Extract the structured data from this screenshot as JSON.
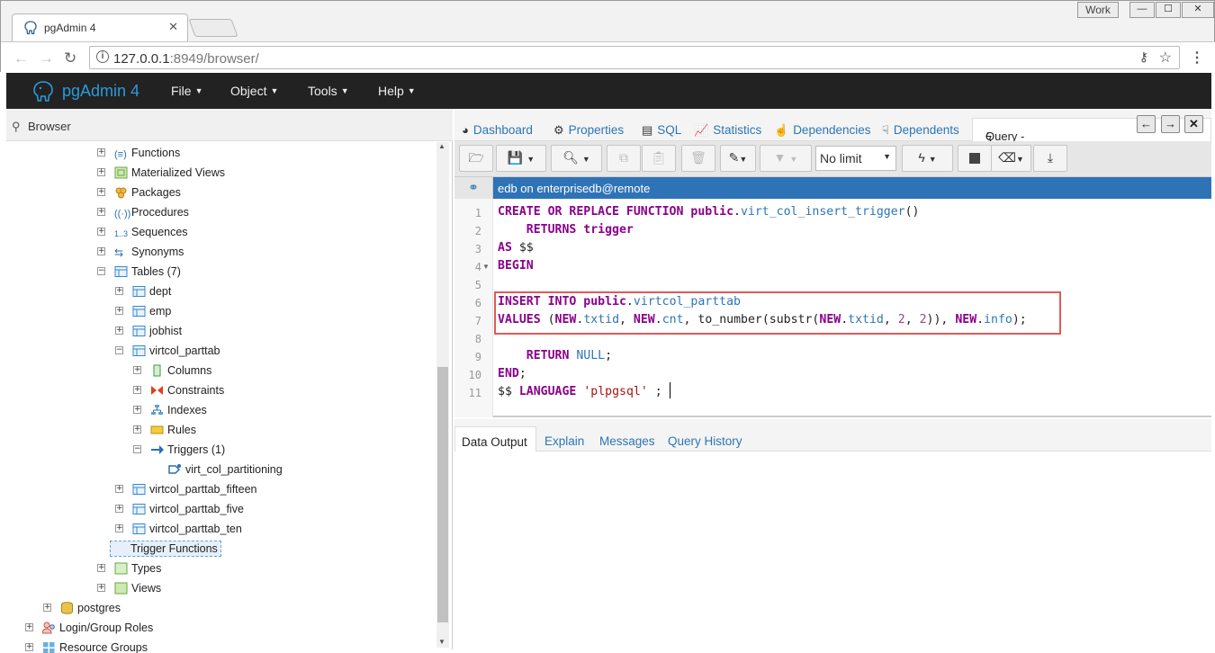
{
  "browser": {
    "tab_title": "pgAdmin 4",
    "profile_label": "Work",
    "url_host": "127.0.0.1",
    "url_rest": ":8949/browser/"
  },
  "app": {
    "name": "pgAdmin 4",
    "menus": [
      "File",
      "Object",
      "Tools",
      "Help"
    ]
  },
  "browser_panel": {
    "title": "Browser",
    "tree": [
      {
        "label": "Functions",
        "level": 3,
        "expander": "+",
        "icon": "functions-icon"
      },
      {
        "label": "Materialized Views",
        "level": 3,
        "expander": "+",
        "icon": "materialized-views-icon"
      },
      {
        "label": "Packages",
        "level": 3,
        "expander": "+",
        "icon": "packages-icon"
      },
      {
        "label": "Procedures",
        "level": 3,
        "expander": "+",
        "icon": "procedures-icon"
      },
      {
        "label": "Sequences",
        "level": 3,
        "expander": "+",
        "icon": "sequences-icon"
      },
      {
        "label": "Synonyms",
        "level": 3,
        "expander": "+",
        "icon": "synonyms-icon"
      },
      {
        "label": "Tables (7)",
        "level": 3,
        "expander": "−",
        "icon": "tables-icon"
      },
      {
        "label": "dept",
        "level": 4,
        "expander": "+",
        "icon": "table-icon"
      },
      {
        "label": "emp",
        "level": 4,
        "expander": "+",
        "icon": "table-icon"
      },
      {
        "label": "jobhist",
        "level": 4,
        "expander": "+",
        "icon": "table-icon"
      },
      {
        "label": "virtcol_parttab",
        "level": 4,
        "expander": "−",
        "icon": "table-icon"
      },
      {
        "label": "Columns",
        "level": 5,
        "expander": "+",
        "icon": "columns-icon"
      },
      {
        "label": "Constraints",
        "level": 5,
        "expander": "+",
        "icon": "constraints-icon"
      },
      {
        "label": "Indexes",
        "level": 5,
        "expander": "+",
        "icon": "indexes-icon"
      },
      {
        "label": "Rules",
        "level": 5,
        "expander": "+",
        "icon": "rules-icon"
      },
      {
        "label": "Triggers (1)",
        "level": 5,
        "expander": "−",
        "icon": "triggers-icon"
      },
      {
        "label": "virt_col_partitioning",
        "level": 6,
        "expander": "",
        "icon": "trigger-icon"
      },
      {
        "label": "virtcol_parttab_fifteen",
        "level": 4,
        "expander": "+",
        "icon": "table-icon"
      },
      {
        "label": "virtcol_parttab_five",
        "level": 4,
        "expander": "+",
        "icon": "table-icon"
      },
      {
        "label": "virtcol_parttab_ten",
        "level": 4,
        "expander": "+",
        "icon": "table-icon"
      },
      {
        "label": "Trigger Functions",
        "level": 3,
        "expander": "",
        "icon": "trigger-functions-icon",
        "selected": true
      },
      {
        "label": "Types",
        "level": 3,
        "expander": "+",
        "icon": "types-icon"
      },
      {
        "label": "Views",
        "level": 3,
        "expander": "+",
        "icon": "views-icon"
      },
      {
        "label": "postgres",
        "level": 2,
        "expander": "+",
        "icon": "database-icon"
      },
      {
        "label": "Login/Group Roles",
        "level": 1,
        "expander": "+",
        "icon": "roles-icon"
      },
      {
        "label": "Resource Groups",
        "level": 1,
        "expander": "+",
        "icon": "resource-groups-icon"
      }
    ]
  },
  "panel_tabs": {
    "dashboard": "Dashboard",
    "properties": "Properties",
    "sql": "SQL",
    "statistics": "Statistics",
    "dependencies": "Dependencies",
    "dependents": "Dependents",
    "query": "Query - edb on enterprised"
  },
  "toolbar": {
    "limit_value": "No limit"
  },
  "connection": {
    "label": "edb on enterprisedb@remote"
  },
  "editor": {
    "line_numbers": [
      "1",
      "2",
      "3",
      "4",
      "5",
      "6",
      "7",
      "8",
      "9",
      "10",
      "11"
    ]
  },
  "result_tabs": {
    "data_output": "Data Output",
    "explain": "Explain",
    "messages": "Messages",
    "query_history": "Query History"
  },
  "colors": {
    "app_bar": "#222222",
    "brand": "#2c9ad8",
    "connection_bar": "#2f73b7",
    "highlight_box": "#e15a5a",
    "keyword": "#8b008b"
  }
}
